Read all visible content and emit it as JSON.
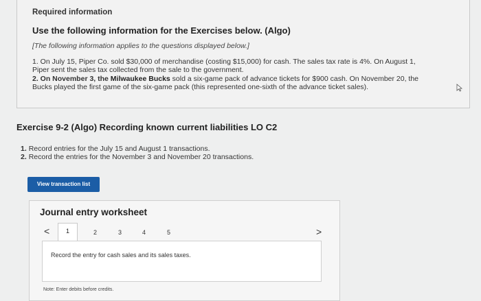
{
  "required": {
    "heading": "Required information",
    "subheading": "Use the following information for the Exercises below. (Algo)",
    "note": "[The following information applies to the questions displayed below.]",
    "item1": {
      "line1": "1. On July 15, Piper Co. sold $30,000 of merchandise (costing $15,000) for cash. The sales tax rate is 4%. On August 1,",
      "line2": "Piper sent the sales tax collected from the sale to the government."
    },
    "item2": {
      "prefix": "2. On November 3, the",
      "bold": "Milwaukee Bucks",
      "line1_rest": "sold a six-game pack of advance tickets for $900 cash. On November 20, the",
      "line2": "Bucks played the first game of the six-game pack (this represented one-sixth of the advance ticket sales)."
    }
  },
  "exercise": {
    "title": "Exercise 9-2 (Algo) Recording known current liabilities LO C2",
    "items": [
      {
        "num": "1.",
        "text": "Record entries for the July 15 and August 1 transactions."
      },
      {
        "num": "2.",
        "text": "Record the entries for the November 3 and November 20 transactions."
      }
    ]
  },
  "view_button": "View transaction list",
  "worksheet": {
    "title": "Journal entry worksheet",
    "prev": "<",
    "next": ">",
    "pages": [
      "1",
      "2",
      "3",
      "4",
      "5"
    ],
    "instruction": "Record the entry for cash sales and its sales taxes.",
    "note": "Note: Enter debits before credits."
  }
}
